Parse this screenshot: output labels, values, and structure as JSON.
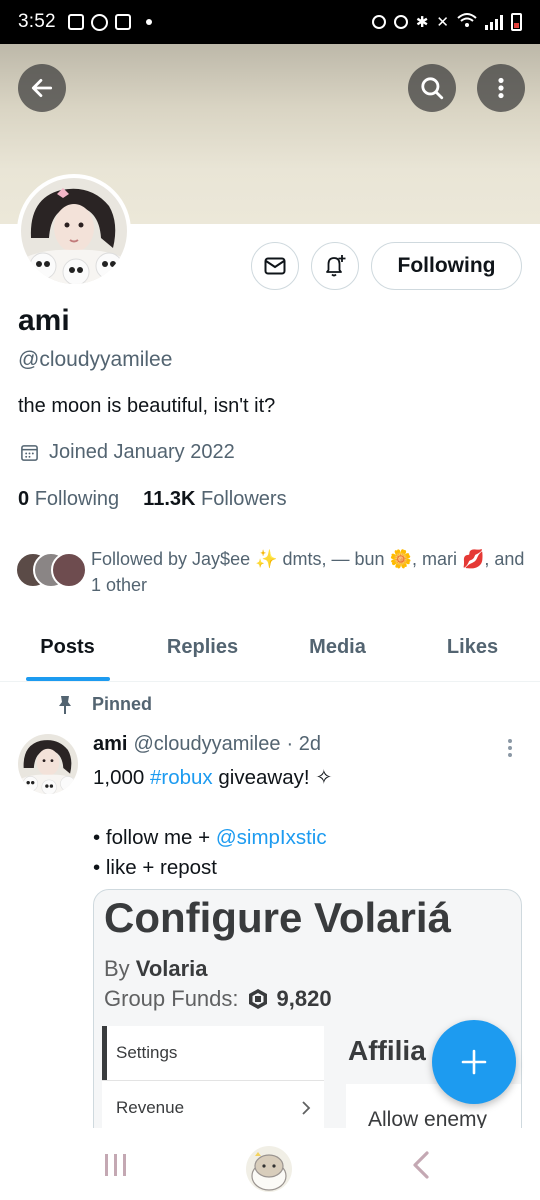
{
  "status_bar": {
    "time": "3:52"
  },
  "header": {
    "back_icon": "arrow-left-icon",
    "search_icon": "search-icon",
    "more_icon": "more-vertical-icon"
  },
  "profile": {
    "display_name": "ami",
    "handle": "@cloudyyamilee",
    "bio": "the moon is beautiful, isn't it?",
    "joined": "Joined January 2022",
    "following_count": "0",
    "following_label": "Following",
    "followers_count": "11.3K",
    "followers_label": "Followers",
    "followed_by": "Followed by Jay$ee ✨ dmts, — bun 🌼, mari 💋, and 1 other",
    "follow_button_label": "Following"
  },
  "tabs": [
    {
      "label": "Posts",
      "active": true
    },
    {
      "label": "Replies",
      "active": false
    },
    {
      "label": "Media",
      "active": false
    },
    {
      "label": "Likes",
      "active": false
    }
  ],
  "post": {
    "pinned_label": "Pinned",
    "author_name": "ami",
    "author_handle": "@cloudyyamilee",
    "time": "· 2d",
    "line1_prefix": "1,000 ",
    "line1_hashtag": "#robux",
    "line1_suffix": " giveaway! ✧",
    "line2_prefix": "• follow me + ",
    "line2_mention": "@simpIxstic",
    "line3": "• like + repost",
    "media": {
      "title": "Configure Volariá",
      "by_label": "By ",
      "by_name": "Volaria",
      "funds_label": "Group Funds:",
      "funds_value": "9,820",
      "menu_items": [
        "Settings",
        "Revenue"
      ],
      "affiliates_heading": "Affilia",
      "allow_text": "Allow enemy"
    }
  },
  "colors": {
    "accent": "#1d9bf0",
    "text_primary": "#0f1419",
    "text_secondary": "#536471"
  }
}
